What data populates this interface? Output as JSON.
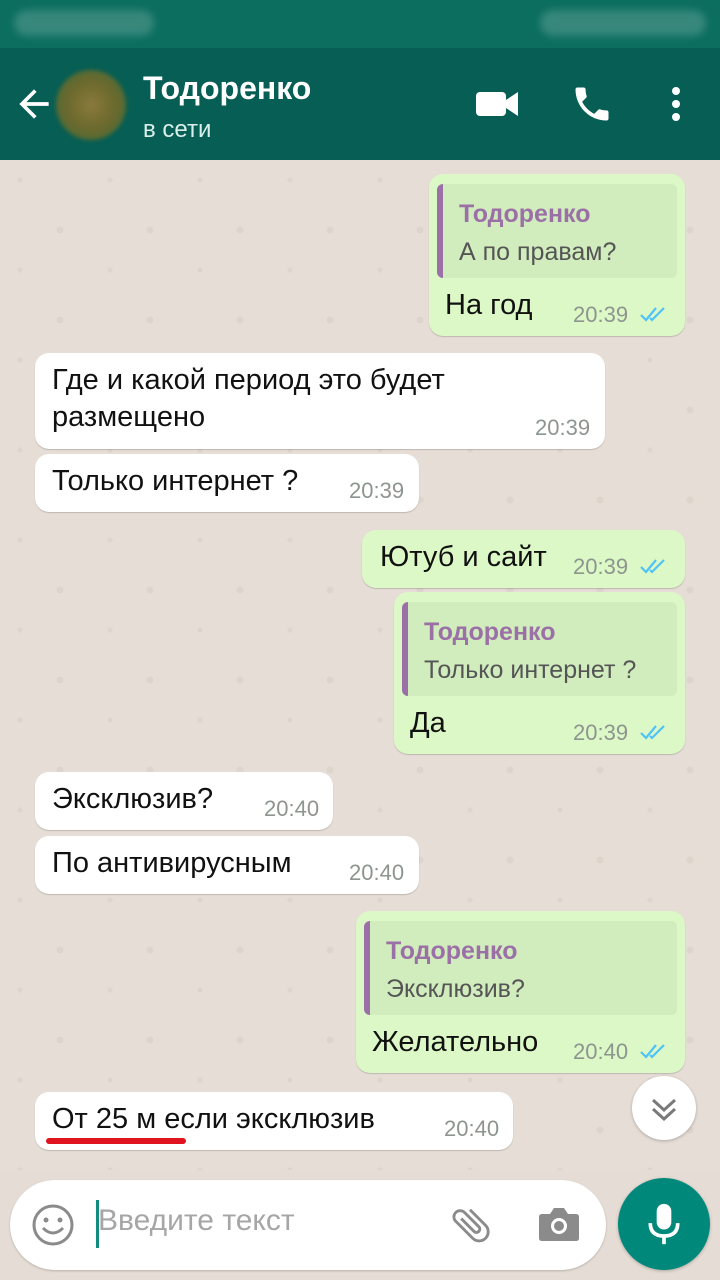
{
  "header": {
    "contact_name": "Тодоренко",
    "status": "в сети"
  },
  "messages": [
    {
      "direction": "outgoing",
      "quote_author": "Тодоренко",
      "quote_text": "А по правам?",
      "text": "На год",
      "time": "20:39",
      "read": true
    },
    {
      "direction": "incoming",
      "text_line1": "Где и какой период это будет",
      "text_line2": "размещено",
      "time": "20:39"
    },
    {
      "direction": "incoming",
      "text": "Только интернет ?",
      "time": "20:39"
    },
    {
      "direction": "outgoing",
      "text": "Ютуб и сайт",
      "time": "20:39",
      "read": true
    },
    {
      "direction": "outgoing",
      "quote_author": "Тодоренко",
      "quote_text": "Только интернет ?",
      "text": "Да",
      "time": "20:39",
      "read": true
    },
    {
      "direction": "incoming",
      "text": "Эксклюзив?",
      "time": "20:40"
    },
    {
      "direction": "incoming",
      "text": "По антивирусным",
      "time": "20:40"
    },
    {
      "direction": "outgoing",
      "quote_author": "Тодоренко",
      "quote_text": "Эксклюзив?",
      "text": "Желательно",
      "time": "20:40",
      "read": true
    },
    {
      "direction": "incoming",
      "text": "От 25 м если эксклюзив",
      "time": "20:40"
    }
  ],
  "input": {
    "placeholder": "Введите текст"
  },
  "icons": {
    "back": "arrow-left-icon",
    "video": "video-camera-icon",
    "call": "phone-icon",
    "more": "more-vert-icon",
    "scroll": "chevron-double-down-icon",
    "emoji": "emoji-icon",
    "attach": "paperclip-icon",
    "camera": "camera-icon",
    "mic": "microphone-icon"
  },
  "colors": {
    "header": "#075e54",
    "outgoing_bubble": "#dcf8c6",
    "incoming_bubble": "#ffffff",
    "quote_accent": "#9b70a7",
    "read_ticks": "#4fc3f7",
    "mic_button": "#00897b",
    "annotation_underline": "#e0141e"
  }
}
